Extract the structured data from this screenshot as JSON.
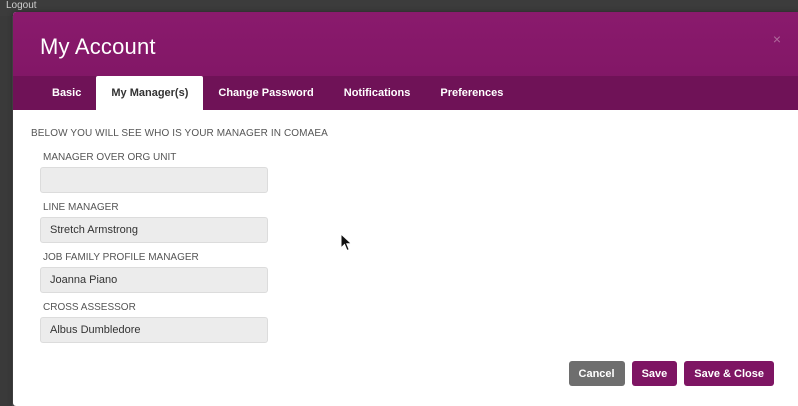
{
  "backdrop": {
    "logout_label": "Logout"
  },
  "modal": {
    "title": "My Account",
    "close_symbol": "×",
    "tabs": [
      {
        "label": "Basic"
      },
      {
        "label": "My Manager(s)",
        "active": true
      },
      {
        "label": "Change Password"
      },
      {
        "label": "Notifications"
      },
      {
        "label": "Preferences"
      }
    ],
    "intro": "BELOW YOU WILL SEE WHO IS YOUR MANAGER IN COMAEA",
    "fields": [
      {
        "label": "MANAGER OVER ORG UNIT",
        "value": ""
      },
      {
        "label": "LINE MANAGER",
        "value": "Stretch Armstrong"
      },
      {
        "label": "JOB FAMILY PROFILE MANAGER",
        "value": "Joanna Piano"
      },
      {
        "label": "CROSS ASSESSOR",
        "value": "Albus Dumbledore"
      }
    ],
    "buttons": {
      "cancel": "Cancel",
      "save": "Save",
      "save_close": "Save & Close"
    }
  },
  "colors": {
    "header": "#8a1a6d",
    "tab_bar": "#6f1257",
    "primary_button": "#7e1563",
    "cancel_button": "#6e6e6e"
  },
  "icons": {
    "close": "close-icon",
    "cursor": "mouse-pointer-icon"
  }
}
